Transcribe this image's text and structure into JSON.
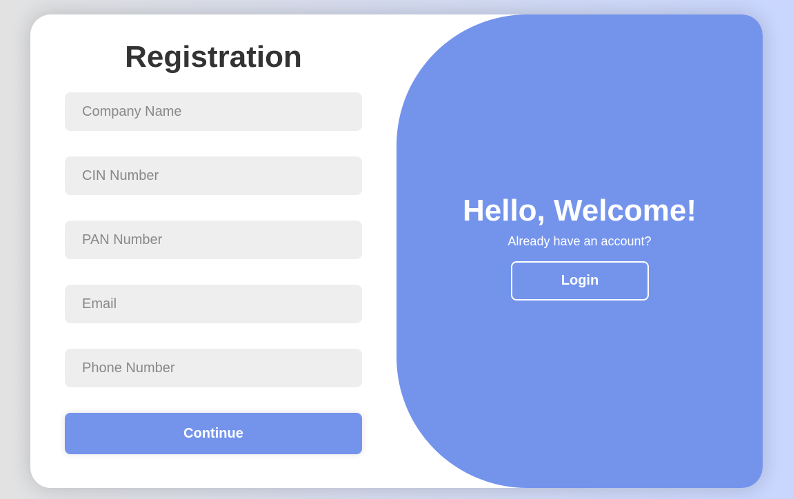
{
  "registration": {
    "title": "Registration",
    "fields": {
      "company_name": {
        "placeholder": "Company Name",
        "value": ""
      },
      "cin_number": {
        "placeholder": "CIN Number",
        "value": ""
      },
      "pan_number": {
        "placeholder": "PAN Number",
        "value": ""
      },
      "email": {
        "placeholder": "Email",
        "value": ""
      },
      "phone_number": {
        "placeholder": "Phone Number",
        "value": ""
      }
    },
    "continue_label": "Continue"
  },
  "welcome_panel": {
    "title": "Hello, Welcome!",
    "subtitle": "Already have an account?",
    "login_label": "Login"
  },
  "colors": {
    "accent": "#7494ec",
    "input_background": "#eeeeee",
    "title_text": "#333333",
    "placeholder_text": "#888888",
    "card_background": "#ffffff"
  }
}
